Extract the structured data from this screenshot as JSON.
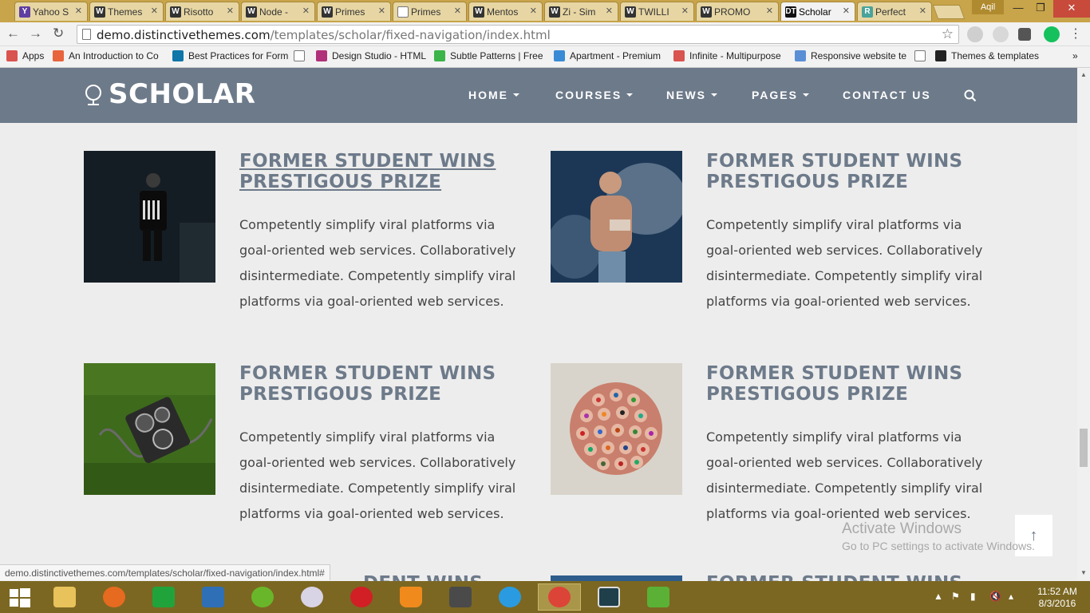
{
  "browser": {
    "tabs": [
      {
        "title": "Yahoo S",
        "favicon": "Y",
        "color": "#5f3ea1"
      },
      {
        "title": "Themes",
        "favicon": "W",
        "color": "#333333"
      },
      {
        "title": "Risotto",
        "favicon": "W",
        "color": "#333333"
      },
      {
        "title": "Node -",
        "favicon": "W",
        "color": "#333333"
      },
      {
        "title": "Primes",
        "favicon": "W",
        "color": "#333333"
      },
      {
        "title": "Primes",
        "favicon": "",
        "color": "#ffffff"
      },
      {
        "title": "Mentos",
        "favicon": "W",
        "color": "#333333"
      },
      {
        "title": "Zi - Sim",
        "favicon": "W",
        "color": "#333333"
      },
      {
        "title": "TWILLI",
        "favicon": "W",
        "color": "#333333"
      },
      {
        "title": "PROMO",
        "favicon": "W",
        "color": "#333333"
      },
      {
        "title": "Scholar",
        "favicon": "DT",
        "color": "#111111"
      },
      {
        "title": "Perfect",
        "favicon": "R",
        "color": "#4aa39c"
      }
    ],
    "user": "Aqil",
    "url_domain": "demo.distinctivethemes.com",
    "url_path": "/templates/scholar/fixed-navigation/index.html",
    "bookmarks": [
      {
        "label": "Apps",
        "color": "#d9534f"
      },
      {
        "label": "An Introduction to Co",
        "color": "#e8643c"
      },
      {
        "label": "Best Practices for Form",
        "color": "#0e76a8"
      },
      {
        "label": "",
        "color": "#ffffff"
      },
      {
        "label": "Design Studio - HTML",
        "color": "#b0307a"
      },
      {
        "label": "Subtle Patterns | Free",
        "color": "#3bb44a"
      },
      {
        "label": "Apartment - Premium",
        "color": "#3a8bd6"
      },
      {
        "label": "Infinite - Multipurpose",
        "color": "#d9534f"
      },
      {
        "label": "Responsive website te",
        "color": "#5a8fd6"
      },
      {
        "label": "",
        "color": "#ffffff"
      },
      {
        "label": "Themes & templates",
        "color": "#222222"
      }
    ],
    "status_url": "demo.distinctivethemes.com/templates/scholar/fixed-navigation/index.html#"
  },
  "site": {
    "logo": "SCHOLAR",
    "nav": [
      "HOME",
      "COURSES",
      "NEWS",
      "PAGES",
      "CONTACT US"
    ],
    "articles": [
      {
        "title": "FORMER STUDENT WINS PRESTIGOUS PRIZE",
        "text": "Competently simplify viral platforms via goal-oriented web services. Collaboratively disintermediate. Competently simplify viral platforms via goal-oriented web services.",
        "image": "person-in-dark-photo"
      },
      {
        "title": "FORMER STUDENT WINS PRESTIGOUS PRIZE",
        "text": "Competently simplify viral platforms via goal-oriented web services. Collaboratively disintermediate. Competently simplify viral platforms via goal-oriented web services.",
        "image": "athlete-chalk-photo"
      },
      {
        "title": "FORMER STUDENT WINS PRESTIGOUS PRIZE",
        "text": "Competently simplify viral platforms via goal-oriented web services. Collaboratively disintermediate. Competently simplify viral platforms via goal-oriented web services.",
        "image": "camera-on-grass-photo"
      },
      {
        "title": "FORMER STUDENT WINS PRESTIGOUS PRIZE",
        "text": "Competently simplify viral platforms via goal-oriented web services. Collaboratively disintermediate. Competently simplify viral platforms via goal-oriented web services.",
        "image": "colored-pencils-photo"
      }
    ],
    "partial_title": "FORMER STUDENT WINS",
    "partial_title_left": "DENT WINS",
    "back_to_top": "↑",
    "header_color": "#6d7a8a"
  },
  "overlay": {
    "watermark_line1": "Activate Windows",
    "watermark_line2": "Go to PC settings to activate Windows."
  },
  "taskbar": {
    "time": "11:52 AM",
    "date": "8/3/2016"
  }
}
